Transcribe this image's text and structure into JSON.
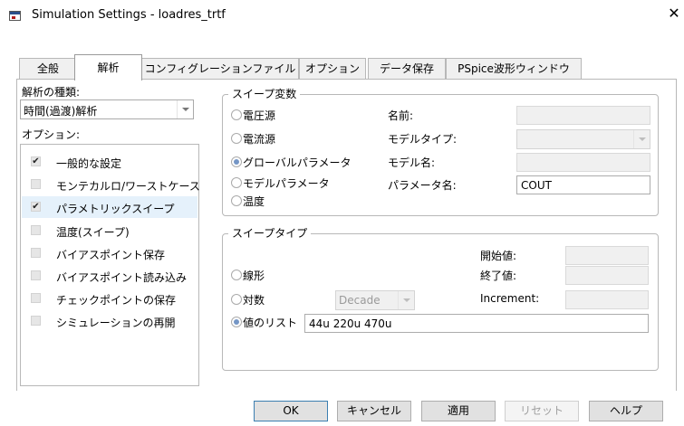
{
  "window": {
    "title": "Simulation Settings - loadres_trtf",
    "close_glyph": "✕"
  },
  "tabs": [
    {
      "label": "全般",
      "active": false
    },
    {
      "label": "解析",
      "active": true
    },
    {
      "label": "コンフィグレーションファイル",
      "active": false
    },
    {
      "label": "オプション",
      "active": false
    },
    {
      "label": "データ保存",
      "active": false
    },
    {
      "label": "PSpice波形ウィンドウ",
      "active": false
    }
  ],
  "analysis": {
    "type_label": "解析の種類:",
    "type_value": "時間(過渡)解析",
    "options_label": "オプション:",
    "options": [
      {
        "label": "一般的な設定",
        "checked": true,
        "selected": false
      },
      {
        "label": "モンテカルロ/ワーストケース",
        "checked": false,
        "selected": false
      },
      {
        "label": "パラメトリックスイープ",
        "checked": true,
        "selected": true
      },
      {
        "label": "温度(スイープ)",
        "checked": false,
        "selected": false
      },
      {
        "label": "バイアスポイント保存",
        "checked": false,
        "selected": false
      },
      {
        "label": "バイアスポイント読み込み",
        "checked": false,
        "selected": false
      },
      {
        "label": "チェックポイントの保存",
        "checked": false,
        "selected": false
      },
      {
        "label": "シミュレーションの再開",
        "checked": false,
        "selected": false
      }
    ],
    "check_glyph": "✔"
  },
  "sweep_variable": {
    "title": "スイープ変数",
    "radios": [
      {
        "label": "電圧源",
        "selected": false
      },
      {
        "label": "電流源",
        "selected": false
      },
      {
        "label": "グローバルパラメータ",
        "selected": true
      },
      {
        "label": "モデルパラメータ",
        "selected": false
      },
      {
        "label": "温度",
        "selected": false
      }
    ],
    "name_label": "名前:",
    "name_value": "",
    "model_type_label": "モデルタイプ:",
    "model_type_value": "",
    "model_name_label": "モデル名:",
    "model_name_value": "",
    "param_name_label": "パラメータ名:",
    "param_name_value": "COUT"
  },
  "sweep_type": {
    "title": "スイープタイプ",
    "radios": [
      {
        "label": "線形",
        "selected": false
      },
      {
        "label": "対数",
        "selected": false
      },
      {
        "label": "値のリスト",
        "selected": true
      }
    ],
    "start_label": "開始値:",
    "end_label": "終了値:",
    "increment_label": "Increment:",
    "log_mode_value": "Decade",
    "value_list": "44u 220u 470u"
  },
  "buttons": {
    "ok": "OK",
    "cancel": "キャンセル",
    "apply": "適用",
    "reset": "リセット",
    "help": "ヘルプ"
  },
  "colors": {
    "radio_dot": "#7596c6",
    "selection_bg": "#e5f1fb",
    "default_button_border": "#3c7fb1"
  }
}
